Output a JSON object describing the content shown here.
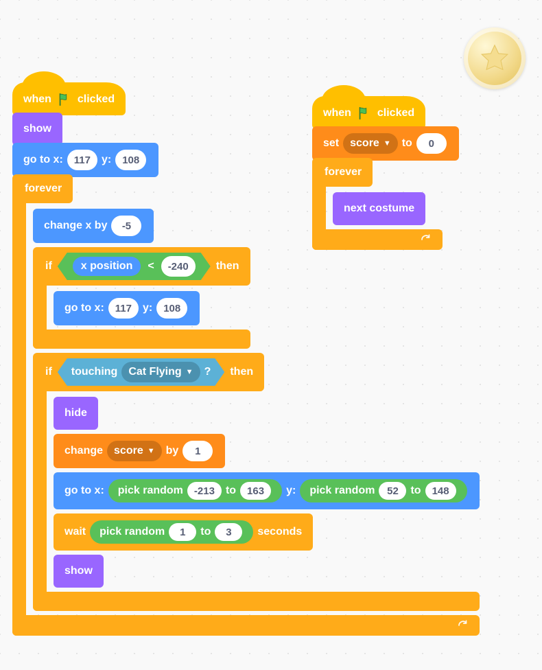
{
  "badge": {
    "name": "star-badge"
  },
  "script_left": {
    "hat": {
      "when": "when",
      "clicked": "clicked"
    },
    "show_label": "show",
    "goto1": {
      "pre_x": "go to x:",
      "x": "117",
      "pre_y": "y:",
      "y": "108"
    },
    "forever_label": "forever",
    "change_x": {
      "label": "change x by",
      "val": "-5"
    },
    "if1": {
      "if": "if",
      "then": "then",
      "cond": {
        "left_reporter": "x position",
        "op": "<",
        "right": "-240"
      },
      "goto": {
        "pre_x": "go to x:",
        "x": "117",
        "pre_y": "y:",
        "y": "108"
      }
    },
    "if2": {
      "if": "if",
      "then": "then",
      "cond": {
        "touching": "touching",
        "target": "Cat Flying",
        "q": "?"
      },
      "hide_label": "hide",
      "change_var": {
        "change": "change",
        "var": "score",
        "by": "by",
        "val": "1"
      },
      "goto_rand": {
        "pre_x": "go to x:",
        "r1": {
          "pick": "pick random",
          "a": "-213",
          "to": "to",
          "b": "163"
        },
        "pre_y": "y:",
        "r2": {
          "pick": "pick random",
          "a": "52",
          "to": "to",
          "b": "148"
        }
      },
      "wait": {
        "wait": "wait",
        "r": {
          "pick": "pick random",
          "a": "1",
          "to": "to",
          "b": "3"
        },
        "seconds": "seconds"
      },
      "show_label": "show"
    }
  },
  "script_right": {
    "hat": {
      "when": "when",
      "clicked": "clicked"
    },
    "setvar": {
      "set": "set",
      "var": "score",
      "to": "to",
      "val": "0"
    },
    "forever_label": "forever",
    "next_costume": "next costume"
  },
  "colors": {
    "events": "#ffbf00",
    "looks": "#9966ff",
    "motion": "#4c97ff",
    "control": "#ffab19",
    "sensing": "#5cb1d6",
    "operators": "#59c059",
    "data": "#ff8c1a"
  }
}
